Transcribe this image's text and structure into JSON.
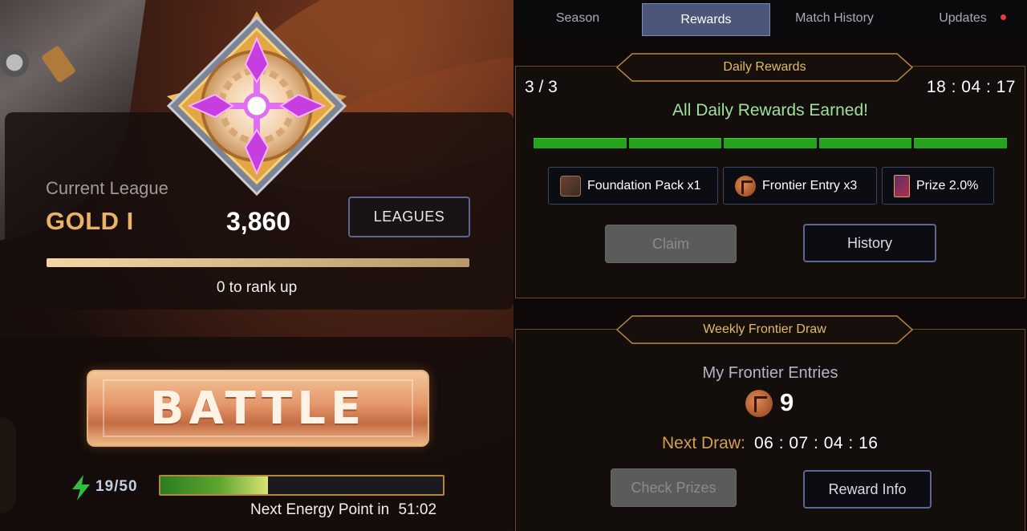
{
  "league": {
    "label": "Current League",
    "name": "GOLD I",
    "points": "3,860",
    "leagues_button": "LEAGUES",
    "rank_progress": 1.0,
    "rank_text": "0 to rank up"
  },
  "battle": {
    "label": "BATTLE",
    "energy_text": "19/50",
    "energy_fraction": 0.38,
    "next_energy_label": "Next Energy Point in",
    "next_energy_time": "51:02"
  },
  "tabs": [
    {
      "label": "Season",
      "active": false
    },
    {
      "label": "Rewards",
      "active": true
    },
    {
      "label": "Match History",
      "active": false
    },
    {
      "label": "Updates",
      "active": false,
      "notification": true
    }
  ],
  "daily": {
    "title": "Daily Rewards",
    "count": "3 / 3",
    "timer": "18 : 04 : 17",
    "status": "All Daily Rewards Earned!",
    "segments_filled": 5,
    "rewards": [
      {
        "label": "Foundation Pack x1",
        "icon": "pack-icon"
      },
      {
        "label": "Frontier Entry x3",
        "icon": "frontier-coin-icon"
      },
      {
        "label": "Prize 2.0%",
        "icon": "prize-card-icon"
      }
    ],
    "claim_button": "Claim",
    "history_button": "History"
  },
  "weekly": {
    "title": "Weekly Frontier Draw",
    "entries_label": "My Frontier Entries",
    "entries_value": "9",
    "next_draw_label": "Next Draw:",
    "next_draw_value": "06 : 07 : 04 : 16",
    "check_prizes_button": "Check Prizes",
    "reward_info_button": "Reward Info"
  },
  "colors": {
    "accent_gold": "#e9b268",
    "success_green": "#27a31f",
    "tab_active": "#4b5678"
  }
}
